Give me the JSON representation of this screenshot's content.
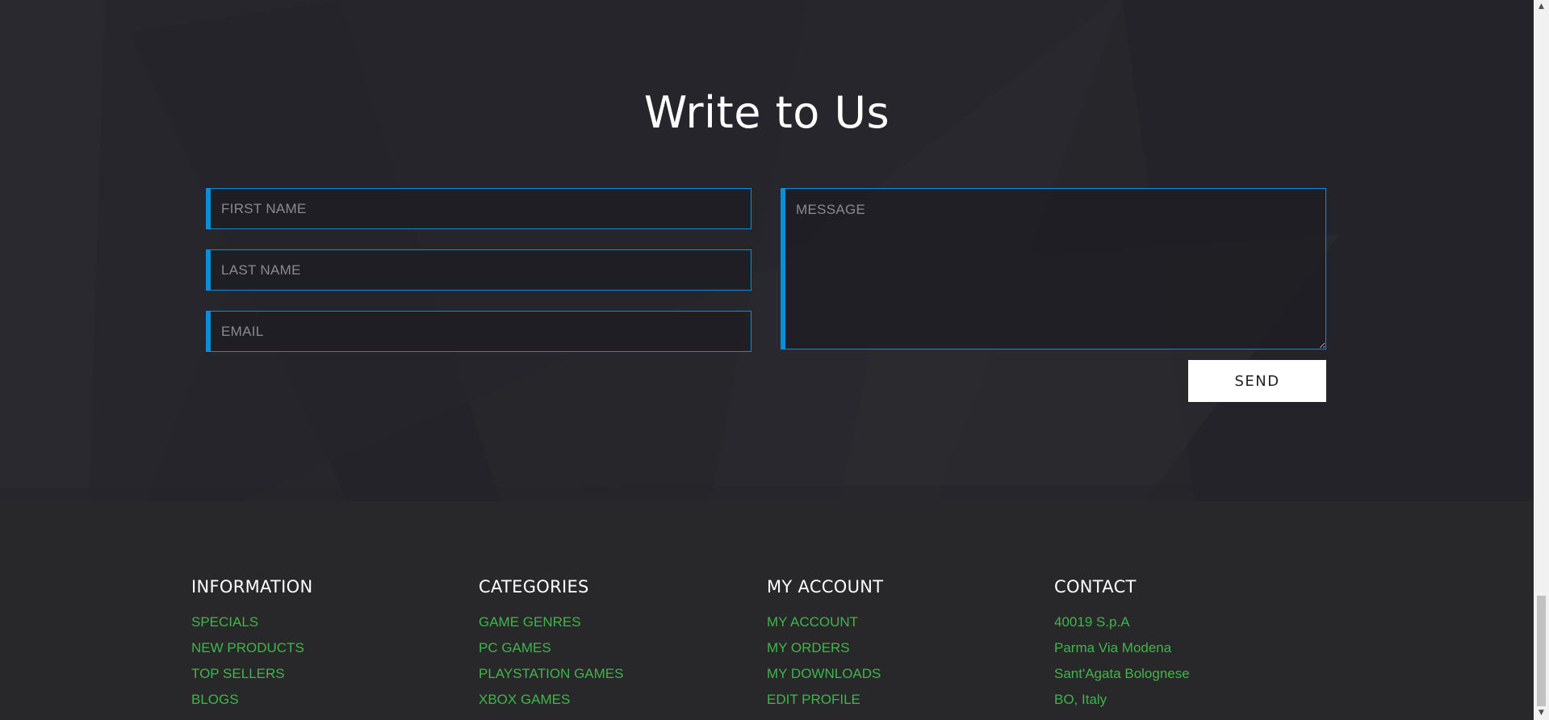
{
  "contact_form": {
    "title": "Write to Us",
    "first_name_placeholder": "FIRST NAME",
    "last_name_placeholder": "LAST NAME",
    "email_placeholder": "EMAIL",
    "message_placeholder": "MESSAGE",
    "send_label": "SEND"
  },
  "footer": {
    "information": {
      "heading": "INFORMATION",
      "links": [
        "SPECIALS",
        "NEW PRODUCTS",
        "TOP SELLERS",
        "BLOGS"
      ]
    },
    "categories": {
      "heading": "CATEGORIES",
      "links": [
        "GAME GENRES",
        "PC GAMES",
        "PLAYSTATION GAMES",
        "XBOX GAMES"
      ]
    },
    "my_account": {
      "heading": "MY ACCOUNT",
      "links": [
        "MY ACCOUNT",
        "MY ORDERS",
        "MY DOWNLOADS",
        "EDIT PROFILE"
      ]
    },
    "contact": {
      "heading": "CONTACT",
      "lines": [
        "40019 S.p.A",
        "Parma Via Modena",
        "Sant'Agata Bolognese",
        "BO, Italy"
      ]
    }
  },
  "colors": {
    "accent_border": "#0a8ed8",
    "link_green": "#3fb54a",
    "background_dark": "#27262b"
  },
  "icons": {
    "scroll_up": "triangle-up-icon",
    "scroll_down": "triangle-down-icon"
  }
}
